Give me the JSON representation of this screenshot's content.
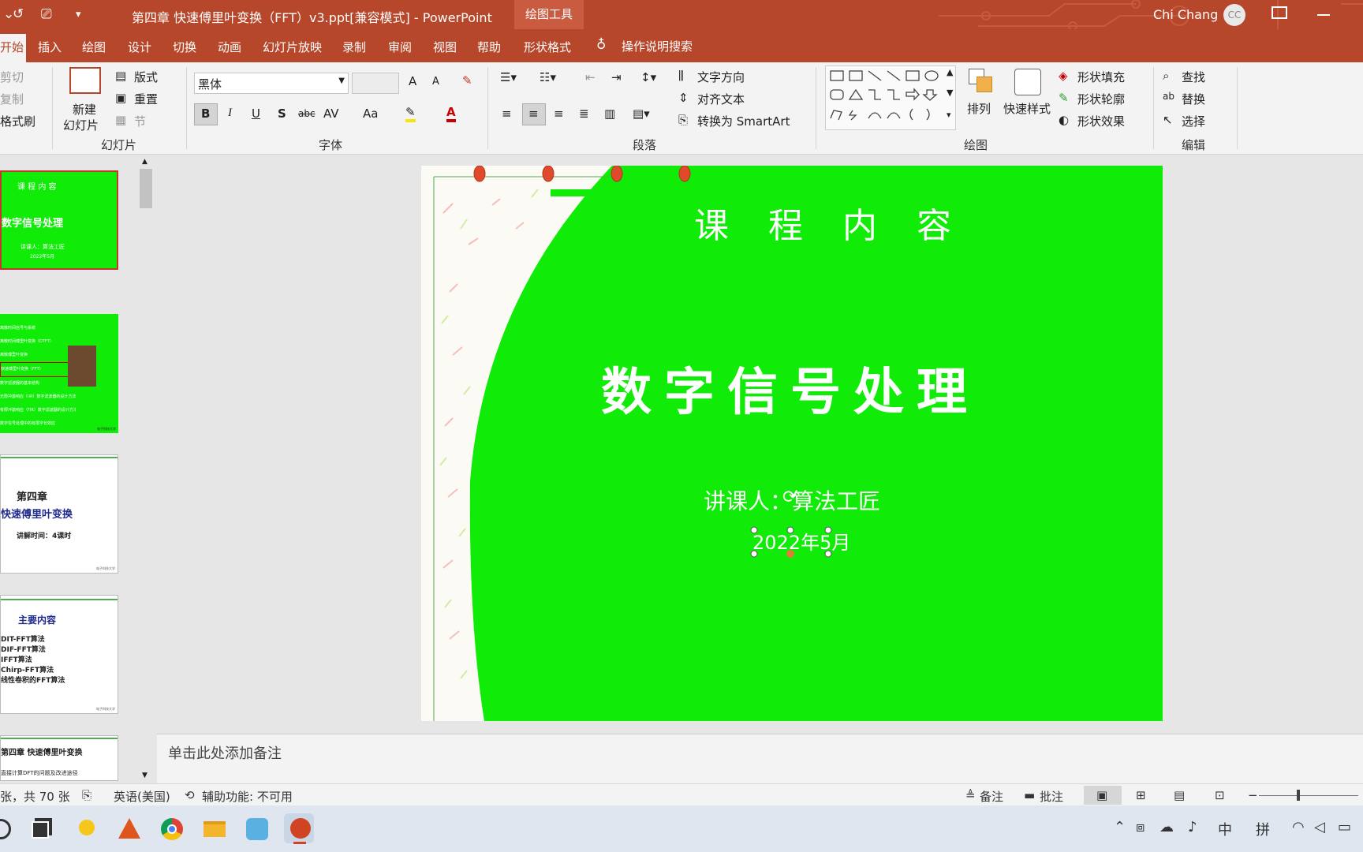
{
  "titlebar": {
    "undo_icon": "↺",
    "present_icon": "⎚",
    "customize_icon": "▾",
    "document_title": "第四章 快速傅里叶变换（FFT）v3.ppt[兼容模式] - PowerPoint",
    "contextual_group": "绘图工具",
    "user_name": "Chi Chang",
    "user_initials": "CC"
  },
  "tabs": [
    "开始",
    "插入",
    "绘图",
    "设计",
    "切换",
    "动画",
    "幻灯片放映",
    "录制",
    "审阅",
    "视图",
    "帮助",
    "形状格式"
  ],
  "tell_me": "操作说明搜索",
  "ribbon": {
    "clipboard": {
      "cut": "剪切",
      "copy": "复制",
      "format_painter": "格式刷"
    },
    "slides": {
      "new_slide_line1": "新建",
      "new_slide_line2": "幻灯片",
      "layout": "版式",
      "reset": "重置",
      "section": "节",
      "group_label": "幻灯片"
    },
    "font": {
      "font_name": "黑体",
      "font_size": "",
      "bold": "B",
      "italic": "I",
      "underline": "U",
      "shadow": "S",
      "strike": "abc",
      "spacing": "AV",
      "case": "Aa",
      "grow": "A",
      "shrink": "A",
      "group_label": "字体"
    },
    "paragraph": {
      "text_direction": "文字方向",
      "align_text": "对齐文本",
      "smartart": "转换为 SmartArt",
      "group_label": "段落"
    },
    "drawing": {
      "arrange": "排列",
      "quick_styles": "快速样式",
      "shape_fill": "形状填充",
      "shape_outline": "形状轮廓",
      "shape_effects": "形状效果",
      "group_label": "绘图"
    },
    "editing": {
      "find": "查找",
      "replace": "替换",
      "select": "选择",
      "group_label": "编辑"
    }
  },
  "thumbnails": [
    {
      "title": "课 程 内 容",
      "main": "数字信号处理",
      "sub1": "讲课人：算法工匠",
      "sub2": "2022年5月"
    },
    {
      "lines": [
        "离散时间信号与系统",
        "离散时间傅里叶变换（DTFT）",
        "离散傅里叶变换",
        "快速傅里叶变换（FFT）",
        "数字滤波器的基本结构",
        "无限冲激响应（IIR）数字滤波器的设计方法",
        "有限冲激响应（FIR）数字滤波器的设计方法",
        "数字信号处理中的有限字长效应"
      ],
      "footer": "电子科技大学"
    },
    {
      "chapter": "第四章",
      "title": "快速傅里叶变换",
      "time": "讲解时间：4课时",
      "footer": "电子科技大学"
    },
    {
      "heading": "主要内容",
      "items": [
        "DIT-FFT算法",
        "DIF-FFT算法",
        "IFFT算法",
        "Chirp-FFT算法",
        "线性卷积的FFT算法"
      ],
      "footer": "电子科技大学"
    },
    {
      "title": "第四章 快速傅里叶变换",
      "line": "直接计算DFT的问题及改进途径"
    }
  ],
  "slide": {
    "top_title": "课 程 内 容",
    "main_title": "数字信号处理",
    "lecturer": "讲课人：算法工匠",
    "date": "2022年5月",
    "bg_color": "#10ec08"
  },
  "notes_placeholder": "单击此处添加备注",
  "statusbar": {
    "slide_count": "张，共 70 张",
    "language": "英语(美国)",
    "accessibility": "辅助功能: 不可用",
    "notes": "备注",
    "comments": "批注",
    "zoom_minus": "−"
  },
  "taskbar": {
    "ime_lang": "中",
    "ime_mode": "拼"
  }
}
